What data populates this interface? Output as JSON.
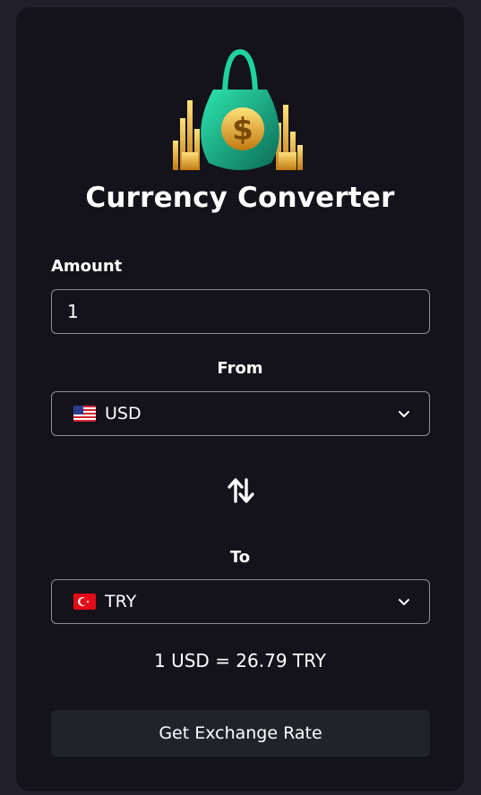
{
  "app": {
    "title": "Currency Converter"
  },
  "amount": {
    "label": "Amount",
    "value": "1"
  },
  "from": {
    "label": "From",
    "code": "USD",
    "flag": "us-flag"
  },
  "to": {
    "label": "To",
    "code": "TRY",
    "flag": "tr-flag"
  },
  "result": {
    "text": "1 USD = 26.79 TRY"
  },
  "button": {
    "label": "Get Exchange Rate"
  },
  "colors": {
    "page_bg": "#221f2c",
    "card_bg": "#14131b",
    "button_bg": "#21232b",
    "border": "#8e8c97"
  }
}
